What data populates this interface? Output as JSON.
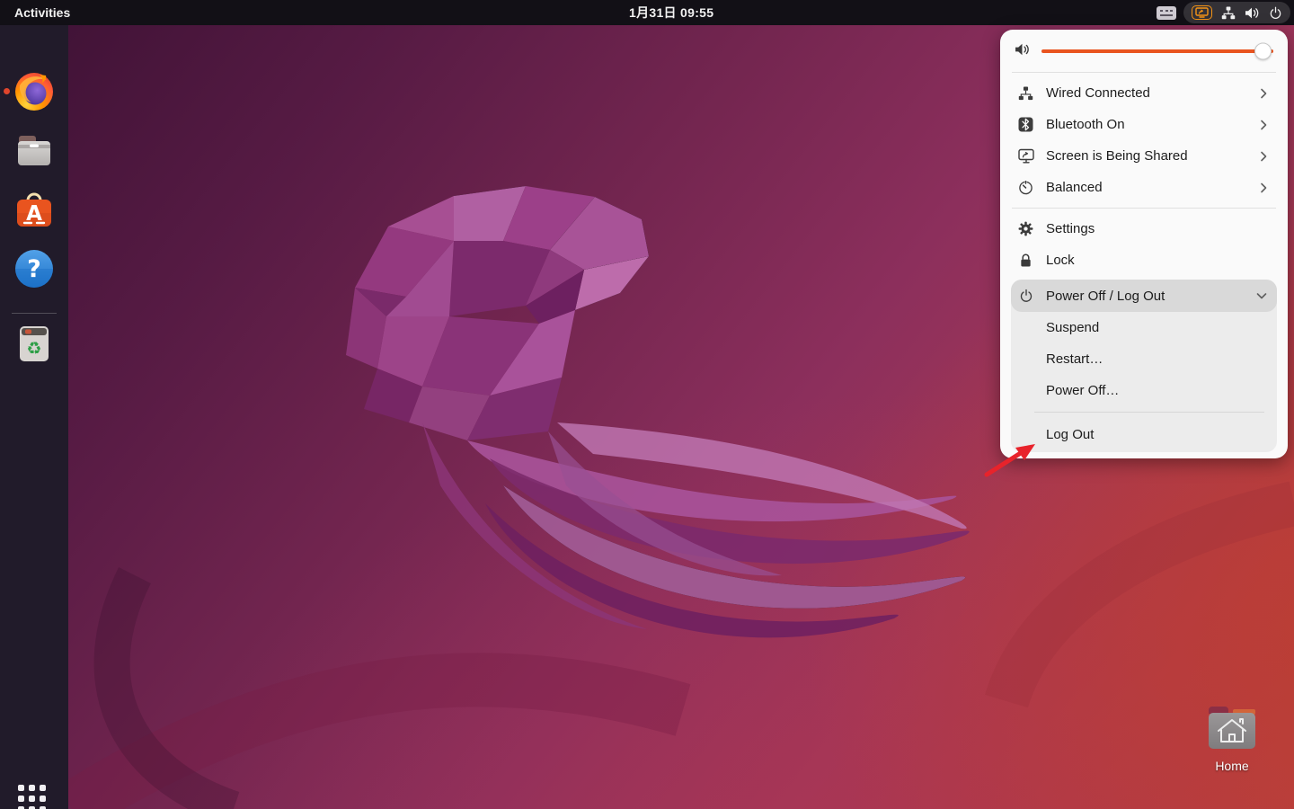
{
  "topbar": {
    "activities_label": "Activities",
    "clock": "1月31日  09:55",
    "tray_icons": [
      "keyboard-indicator",
      "screen-share-active",
      "network-wired",
      "volume",
      "power"
    ]
  },
  "dock": {
    "icons": [
      "firefox",
      "files",
      "ubuntu-software",
      "help",
      "trash",
      "show-applications"
    ],
    "firefox_running": true
  },
  "quick_menu": {
    "volume_percent": 97,
    "rows": [
      {
        "icon": "network-wired-icon",
        "label": "Wired Connected",
        "chevron": "right"
      },
      {
        "icon": "bluetooth-icon",
        "label": "Bluetooth On",
        "chevron": "right"
      },
      {
        "icon": "screen-share-icon",
        "label": "Screen is Being Shared",
        "chevron": "right"
      },
      {
        "icon": "power-profile-icon",
        "label": "Balanced",
        "chevron": "right"
      }
    ],
    "settings_label": "Settings",
    "lock_label": "Lock",
    "power_label": "Power Off / Log Out",
    "power_expanded": true,
    "submenu": {
      "suspend": "Suspend",
      "restart": "Restart…",
      "power_off": "Power Off…",
      "log_out": "Log Out"
    }
  },
  "desktop": {
    "home_label": "Home"
  },
  "colors": {
    "accent_orange": "#E9541F",
    "tray_share_orange": "#f59416",
    "annotation_arrow_red": "#e8232b",
    "panel_bg": "#fafafa",
    "power_row_highlight": "#d9d9d9",
    "submenu_bg": "#ececec",
    "topbar_bg": "#121016",
    "dock_bg": "#211b2a"
  }
}
